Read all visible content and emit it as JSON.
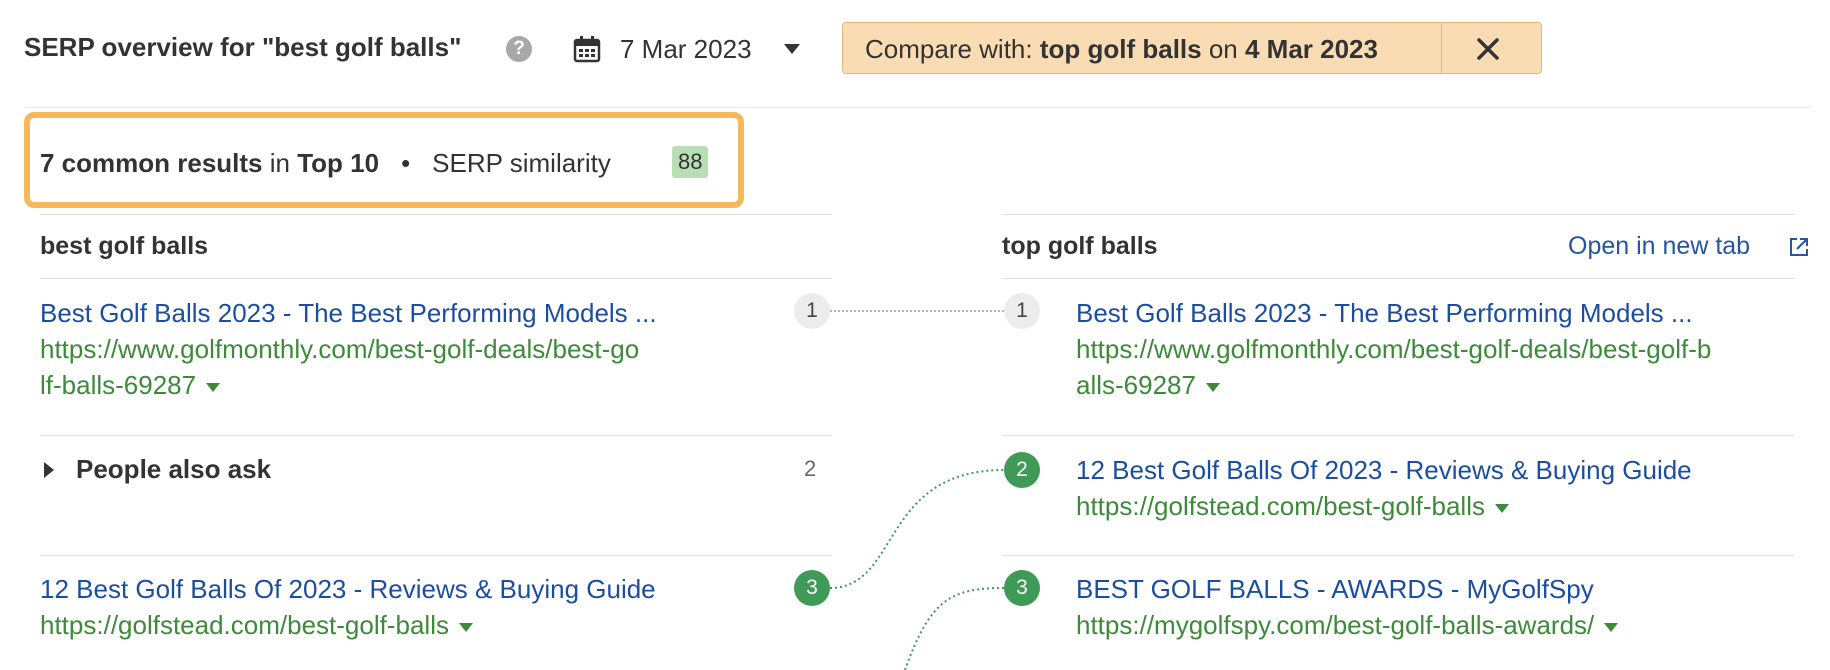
{
  "header": {
    "title": "SERP overview for \"best golf balls\"",
    "help_icon": "?",
    "calendar_icon": "calendar-icon",
    "date": "7 Mar 2023",
    "compare_prefix": "Compare with: ",
    "compare_keyword": "top golf balls",
    "compare_on": " on ",
    "compare_date": "4 Mar 2023",
    "close_icon": "close-icon"
  },
  "summary": {
    "count_text": "7 common results",
    "in_text": " in ",
    "top_text": "Top 10",
    "dot": "•",
    "similarity_label": "SERP similarity",
    "similarity_value": "88"
  },
  "left_column": {
    "heading": "best golf balls",
    "results": [
      {
        "rank": "1",
        "title": "Best Golf Balls 2023 - The Best Performing Models ...",
        "url_line1": "https://www.golfmonthly.com/best-golf-deals/best-go",
        "url_line2": "lf-balls-69287"
      },
      {
        "rank": "3",
        "title": "12 Best Golf Balls Of 2023 - Reviews & Buying Guide",
        "url_line1": "https://golfstead.com/best-golf-balls"
      }
    ],
    "people_also_ask": {
      "label": "People also ask",
      "rank": "2"
    }
  },
  "right_column": {
    "heading": "top golf balls",
    "open_link": "Open in new tab",
    "results": [
      {
        "rank": "1",
        "title": "Best Golf Balls 2023 - The Best Performing Models ...",
        "url_line1": "https://www.golfmonthly.com/best-golf-deals/best-golf-b",
        "url_line2": "alls-69287"
      },
      {
        "rank": "2",
        "title": "12 Best Golf Balls Of 2023 - Reviews & Buying Guide",
        "url_line1": "https://golfstead.com/best-golf-balls"
      },
      {
        "rank": "3",
        "title": "BEST GOLF BALLS - AWARDS - MyGolfSpy",
        "url_line1": "https://mygolfspy.com/best-golf-balls-awards/"
      }
    ]
  },
  "colors": {
    "link_blue": "#1c4ea0",
    "url_green": "#3d8a3a",
    "rank_green": "#3e9a56",
    "compare_bg": "#f9dcb3",
    "highlight_border": "#f5b85c",
    "similarity_bg": "#b8dfb4"
  }
}
